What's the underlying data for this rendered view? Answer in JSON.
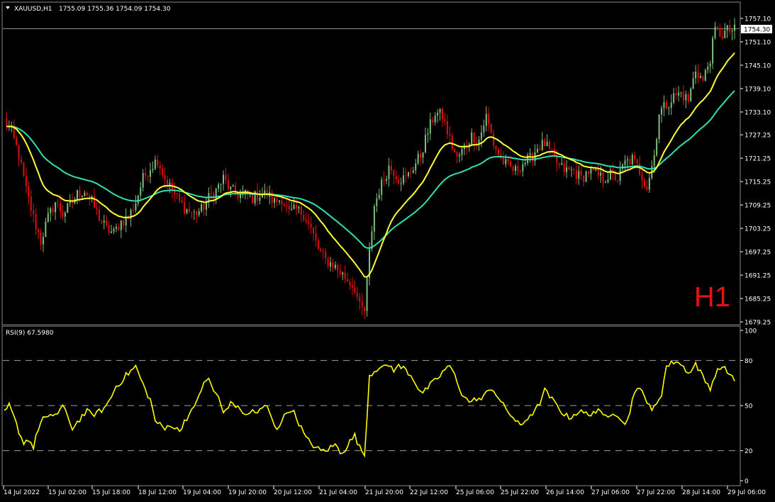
{
  "header": {
    "symbol_label": "XAUUSD,H1",
    "ohlc": "1755.09 1755.36 1754.09 1754.30",
    "dropdown_icon": "triangle-down-icon"
  },
  "price_panel": {
    "current_price_label": "1754.30",
    "timeframe_watermark": "H1",
    "y_ticks": [
      "1757.10",
      "1751.10",
      "1745.10",
      "1739.10",
      "1733.10",
      "1727.25",
      "1721.25",
      "1715.25",
      "1709.25",
      "1703.25",
      "1697.25",
      "1691.25",
      "1685.25",
      "1679.25"
    ]
  },
  "rsi_panel": {
    "label": "RSI(9) 67.5980",
    "y_ticks": [
      "100",
      "80",
      "50",
      "20",
      "0"
    ]
  },
  "x_ticks": [
    "14 Jul 2022",
    "15 Jul 02:00",
    "15 Jul 18:00",
    "18 Jul 12:00",
    "19 Jul 04:00",
    "19 Jul 20:00",
    "20 Jul 12:00",
    "21 Jul 04:00",
    "21 Jul 20:00",
    "22 Jul 12:00",
    "25 Jul 06:00",
    "25 Jul 22:00",
    "26 Jul 14:00",
    "27 Jul 06:00",
    "27 Jul 22:00",
    "28 Jul 14:00",
    "29 Jul 06:00"
  ],
  "colors": {
    "background": "#000000",
    "bull_candle": "#7FBF7F",
    "bear_candle": "#E01010",
    "ma_fast": "#FFFF33",
    "ma_slow": "#2FE0B0",
    "rsi_line": "#FFFF00",
    "watermark": "#E81010",
    "grid_dash": "#A0A0A0"
  },
  "chart_data": [
    {
      "type": "candlestick",
      "title": "XAUUSD,H1",
      "ylim": [
        1679.25,
        1757.1
      ],
      "price_anchors": [
        [
          0,
          1731
        ],
        [
          3,
          1728
        ],
        [
          6,
          1722
        ],
        [
          9,
          1713
        ],
        [
          12,
          1706
        ],
        [
          15,
          1700
        ],
        [
          18,
          1706
        ],
        [
          21,
          1710
        ],
        [
          24,
          1707
        ],
        [
          27,
          1709
        ],
        [
          30,
          1712
        ],
        [
          33,
          1713
        ],
        [
          36,
          1710
        ],
        [
          39,
          1706
        ],
        [
          42,
          1703
        ],
        [
          45,
          1702
        ],
        [
          48,
          1705
        ],
        [
          51,
          1706
        ],
        [
          54,
          1710
        ],
        [
          57,
          1716
        ],
        [
          60,
          1719
        ],
        [
          63,
          1721
        ],
        [
          66,
          1716
        ],
        [
          69,
          1713
        ],
        [
          72,
          1710
        ],
        [
          75,
          1708
        ],
        [
          78,
          1707
        ],
        [
          81,
          1708
        ],
        [
          84,
          1711
        ],
        [
          87,
          1713
        ],
        [
          90,
          1716
        ],
        [
          93,
          1713
        ],
        [
          96,
          1712
        ],
        [
          99,
          1712
        ],
        [
          102,
          1711
        ],
        [
          105,
          1712
        ],
        [
          108,
          1712
        ],
        [
          111,
          1710
        ],
        [
          114,
          1711
        ],
        [
          117,
          1707
        ],
        [
          120,
          1708
        ],
        [
          123,
          1707
        ],
        [
          126,
          1703
        ],
        [
          129,
          1698
        ],
        [
          132,
          1695
        ],
        [
          135,
          1694
        ],
        [
          138,
          1692
        ],
        [
          141,
          1690
        ],
        [
          144,
          1688
        ],
        [
          146,
          1683
        ],
        [
          148,
          1682
        ],
        [
          150,
          1697
        ],
        [
          152,
          1709
        ],
        [
          154,
          1713
        ],
        [
          156,
          1716
        ],
        [
          158,
          1719
        ],
        [
          160,
          1718
        ],
        [
          162,
          1716
        ],
        [
          165,
          1716
        ],
        [
          168,
          1719
        ],
        [
          171,
          1722
        ],
        [
          174,
          1728
        ],
        [
          177,
          1733
        ],
        [
          180,
          1732
        ],
        [
          183,
          1726
        ],
        [
          186,
          1721
        ],
        [
          189,
          1724
        ],
        [
          192,
          1727
        ],
        [
          195,
          1726
        ],
        [
          198,
          1732
        ],
        [
          201,
          1725
        ],
        [
          204,
          1721
        ],
        [
          207,
          1719
        ],
        [
          210,
          1718
        ],
        [
          213,
          1720
        ],
        [
          216,
          1721
        ],
        [
          219,
          1724
        ],
        [
          222,
          1725
        ],
        [
          225,
          1722
        ],
        [
          228,
          1719
        ],
        [
          231,
          1718
        ],
        [
          234,
          1718
        ],
        [
          237,
          1716
        ],
        [
          240,
          1718
        ],
        [
          243,
          1717
        ],
        [
          246,
          1716
        ],
        [
          249,
          1717
        ],
        [
          252,
          1716
        ],
        [
          255,
          1720
        ],
        [
          258,
          1721
        ],
        [
          261,
          1718
        ],
        [
          264,
          1714
        ],
        [
          267,
          1722
        ],
        [
          269,
          1733
        ],
        [
          272,
          1735
        ],
        [
          275,
          1737
        ],
        [
          278,
          1738
        ],
        [
          281,
          1736
        ],
        [
          284,
          1744
        ],
        [
          287,
          1741
        ],
        [
          290,
          1747
        ],
        [
          292,
          1754
        ],
        [
          295,
          1753
        ],
        [
          297,
          1754
        ],
        [
          300,
          1754
        ]
      ]
    },
    {
      "type": "line",
      "title": "RSI(9) 67.5980",
      "ylim": [
        0,
        100
      ],
      "levels": [
        20,
        50,
        80
      ],
      "current_value": 67.598,
      "rsi_anchors": [
        [
          0,
          45
        ],
        [
          2,
          50
        ],
        [
          4,
          42
        ],
        [
          6,
          33
        ],
        [
          8,
          25
        ],
        [
          10,
          28
        ],
        [
          12,
          22
        ],
        [
          14,
          35
        ],
        [
          16,
          42
        ],
        [
          18,
          41
        ],
        [
          20,
          44
        ],
        [
          22,
          45
        ],
        [
          24,
          50
        ],
        [
          26,
          42
        ],
        [
          28,
          35
        ],
        [
          30,
          39
        ],
        [
          32,
          43
        ],
        [
          34,
          46
        ],
        [
          36,
          44
        ],
        [
          38,
          45
        ],
        [
          40,
          47
        ],
        [
          42,
          50
        ],
        [
          44,
          56
        ],
        [
          46,
          63
        ],
        [
          48,
          66
        ],
        [
          50,
          70
        ],
        [
          52,
          73
        ],
        [
          54,
          76
        ],
        [
          56,
          68
        ],
        [
          58,
          60
        ],
        [
          60,
          54
        ],
        [
          62,
          40
        ],
        [
          64,
          37
        ],
        [
          66,
          34
        ],
        [
          68,
          38
        ],
        [
          70,
          35
        ],
        [
          72,
          33
        ],
        [
          74,
          40
        ],
        [
          76,
          44
        ],
        [
          78,
          48
        ],
        [
          80,
          58
        ],
        [
          82,
          64
        ],
        [
          84,
          68
        ],
        [
          86,
          60
        ],
        [
          88,
          55
        ],
        [
          90,
          45
        ],
        [
          92,
          50
        ],
        [
          94,
          52
        ],
        [
          96,
          48
        ],
        [
          98,
          46
        ],
        [
          100,
          43
        ],
        [
          102,
          47
        ],
        [
          104,
          45
        ],
        [
          106,
          48
        ],
        [
          108,
          50
        ],
        [
          110,
          40
        ],
        [
          112,
          35
        ],
        [
          114,
          40
        ],
        [
          116,
          45
        ],
        [
          118,
          48
        ],
        [
          120,
          42
        ],
        [
          122,
          35
        ],
        [
          124,
          28
        ],
        [
          126,
          25
        ],
        [
          128,
          22
        ],
        [
          130,
          20
        ],
        [
          132,
          20
        ],
        [
          134,
          22
        ],
        [
          136,
          24
        ],
        [
          138,
          19
        ],
        [
          140,
          21
        ],
        [
          142,
          26
        ],
        [
          144,
          30
        ],
        [
          146,
          22
        ],
        [
          148,
          17
        ],
        [
          150,
          70
        ],
        [
          152,
          73
        ],
        [
          154,
          76
        ],
        [
          156,
          75
        ],
        [
          158,
          77
        ],
        [
          160,
          74
        ],
        [
          162,
          76
        ],
        [
          164,
          75
        ],
        [
          166,
          72
        ],
        [
          168,
          68
        ],
        [
          170,
          62
        ],
        [
          172,
          58
        ],
        [
          174,
          62
        ],
        [
          176,
          65
        ],
        [
          178,
          68
        ],
        [
          180,
          72
        ],
        [
          182,
          76
        ],
        [
          184,
          74
        ],
        [
          186,
          66
        ],
        [
          188,
          58
        ],
        [
          190,
          54
        ],
        [
          192,
          52
        ],
        [
          194,
          55
        ],
        [
          196,
          54
        ],
        [
          198,
          58
        ],
        [
          200,
          62
        ],
        [
          202,
          58
        ],
        [
          204,
          52
        ],
        [
          206,
          48
        ],
        [
          208,
          44
        ],
        [
          210,
          40
        ],
        [
          212,
          36
        ],
        [
          214,
          40
        ],
        [
          216,
          44
        ],
        [
          218,
          46
        ],
        [
          220,
          52
        ],
        [
          222,
          60
        ],
        [
          224,
          56
        ],
        [
          226,
          52
        ],
        [
          228,
          48
        ],
        [
          230,
          44
        ],
        [
          232,
          42
        ],
        [
          234,
          44
        ],
        [
          236,
          46
        ],
        [
          238,
          45
        ],
        [
          240,
          44
        ],
        [
          242,
          46
        ],
        [
          244,
          46
        ],
        [
          246,
          43
        ],
        [
          248,
          44
        ],
        [
          250,
          46
        ],
        [
          252,
          44
        ],
        [
          254,
          38
        ],
        [
          256,
          40
        ],
        [
          258,
          54
        ],
        [
          260,
          60
        ],
        [
          262,
          62
        ],
        [
          264,
          52
        ],
        [
          266,
          46
        ],
        [
          268,
          52
        ],
        [
          270,
          58
        ],
        [
          272,
          76
        ],
        [
          274,
          78
        ],
        [
          276,
          80
        ],
        [
          278,
          77
        ],
        [
          280,
          74
        ],
        [
          282,
          72
        ],
        [
          284,
          78
        ],
        [
          286,
          72
        ],
        [
          288,
          66
        ],
        [
          290,
          62
        ],
        [
          292,
          70
        ],
        [
          294,
          76
        ],
        [
          296,
          74
        ],
        [
          298,
          71
        ],
        [
          300,
          68
        ]
      ]
    }
  ]
}
